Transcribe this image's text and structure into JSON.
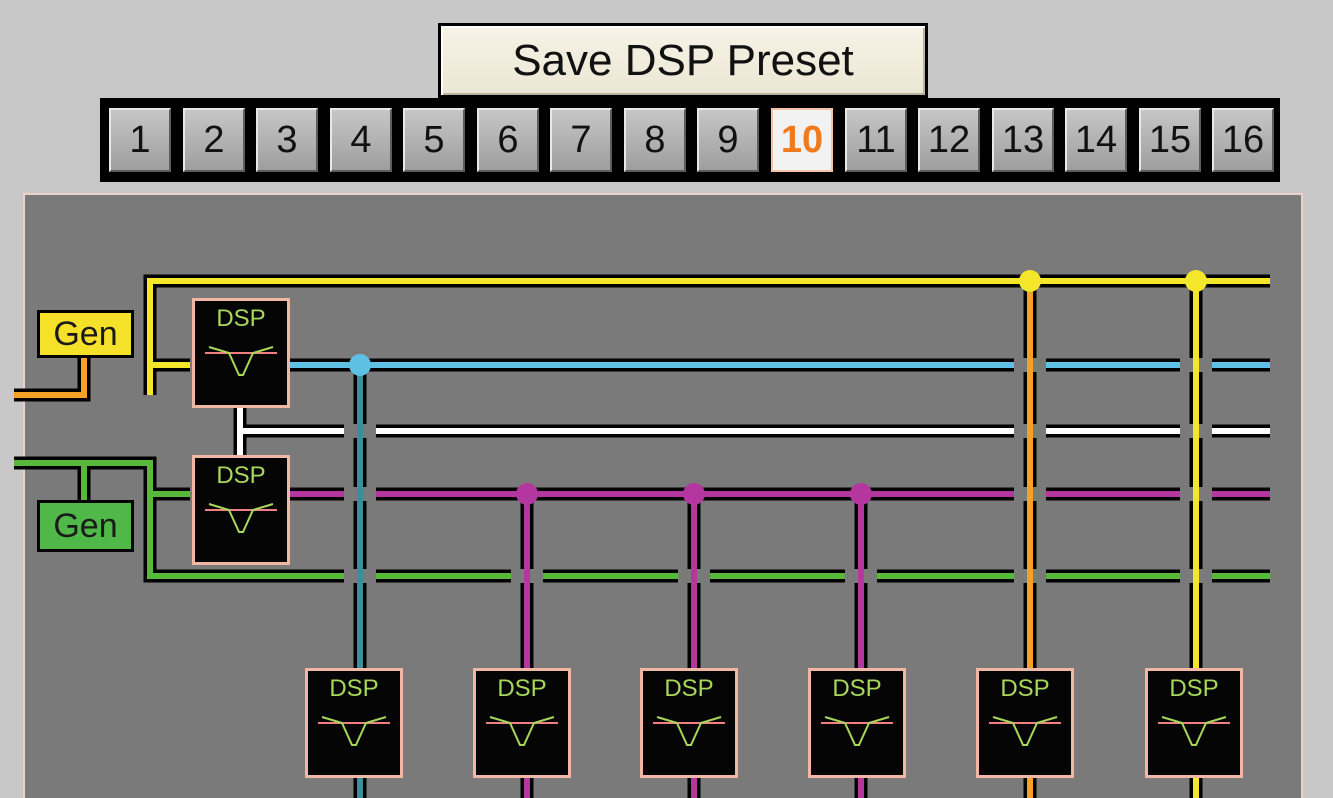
{
  "save_button": {
    "label": "Save DSP Preset"
  },
  "presets": {
    "active": "10",
    "buttons": [
      "1",
      "2",
      "3",
      "4",
      "5",
      "6",
      "7",
      "8",
      "9",
      "10",
      "11",
      "12",
      "13",
      "14",
      "15",
      "16"
    ]
  },
  "generators": [
    {
      "label": "Gen",
      "color": "#f6e12a"
    },
    {
      "label": "Gen",
      "color": "#4fb848"
    }
  ],
  "dsp_label": "DSP",
  "bus_colors": {
    "yellow": "#f4e62a",
    "cyan": "#5ec1e3",
    "white": "#ffffff",
    "magenta": "#b3379f",
    "green": "#58b83a",
    "orange": "#f4a124",
    "teal": "#3c8e9e"
  }
}
